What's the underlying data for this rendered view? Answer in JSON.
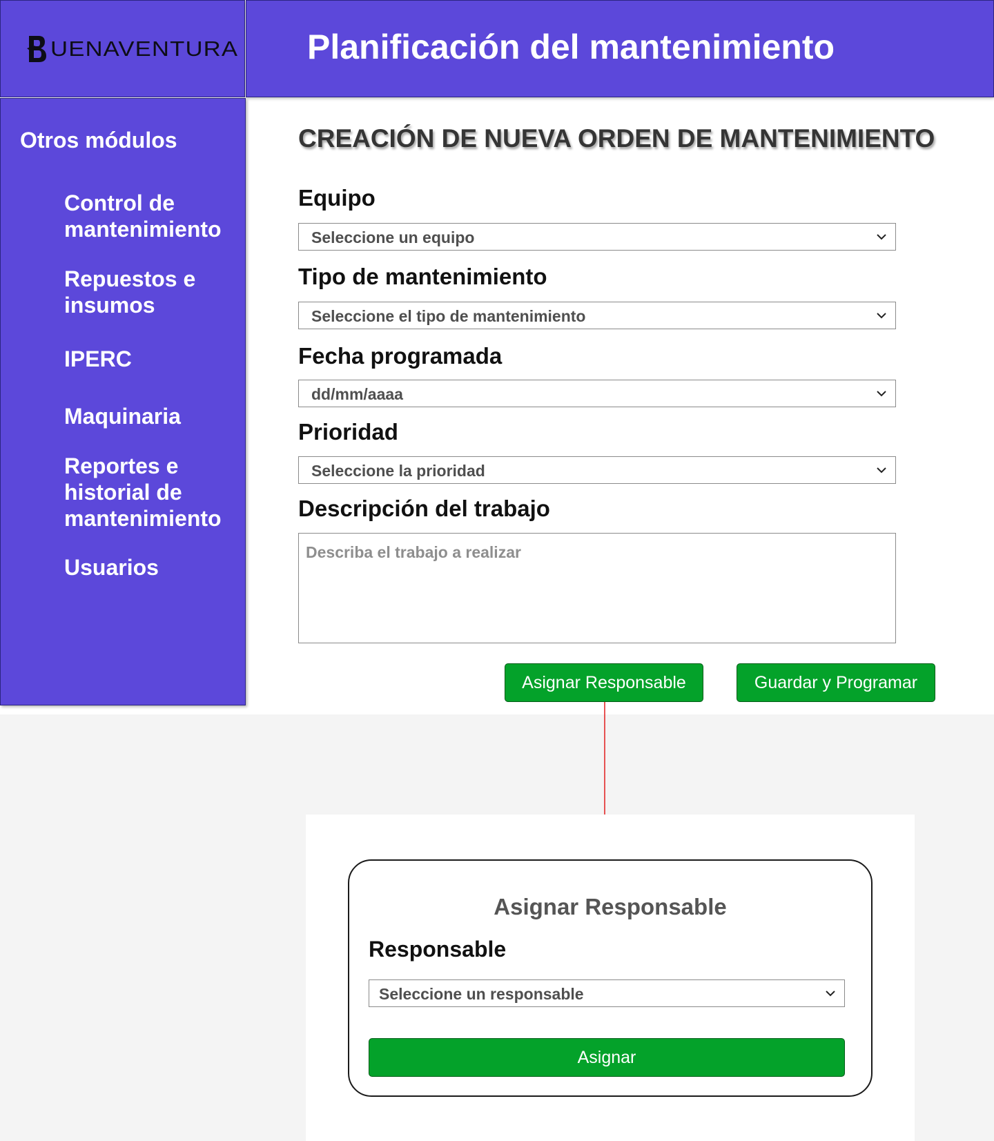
{
  "brand": {
    "logo_text": "UENAVENTURA"
  },
  "header": {
    "title": "Planificación del mantenimiento"
  },
  "sidebar": {
    "heading": "Otros módulos",
    "items": [
      {
        "label": "Control de mantenimiento"
      },
      {
        "label": "Repuestos e insumos"
      },
      {
        "label": "IPERC"
      },
      {
        "label": "Maquinaria"
      },
      {
        "label": "Reportes e historial de mantenimiento"
      },
      {
        "label": "Usuarios"
      }
    ]
  },
  "form": {
    "heading": "CREACIÓN DE NUEVA ORDEN DE MANTENIMIENTO",
    "equipo": {
      "label": "Equipo",
      "value": "Seleccione un equipo"
    },
    "tipo": {
      "label": "Tipo de mantenimiento",
      "value": "Seleccione el tipo de mantenimiento"
    },
    "fecha": {
      "label": "Fecha programada",
      "value": "dd/mm/aaaa"
    },
    "prioridad": {
      "label": "Prioridad",
      "value": "Seleccione la prioridad"
    },
    "descripcion": {
      "label": "Descripción del trabajo",
      "placeholder": "Describa el trabajo a realizar"
    },
    "buttons": {
      "assign": "Asignar Responsable",
      "save": "Guardar y Programar"
    }
  },
  "modal": {
    "title": "Asignar Responsable",
    "responsable": {
      "label": "Responsable",
      "value": "Seleccione un responsable"
    },
    "assign_button": "Asignar"
  },
  "colors": {
    "primary": "#5c48da",
    "button_green": "#04a22a",
    "connector_red": "#e11b1b"
  },
  "icons": {
    "select": "chevron-down-icon",
    "logo": "buenaventura-b-logo"
  }
}
